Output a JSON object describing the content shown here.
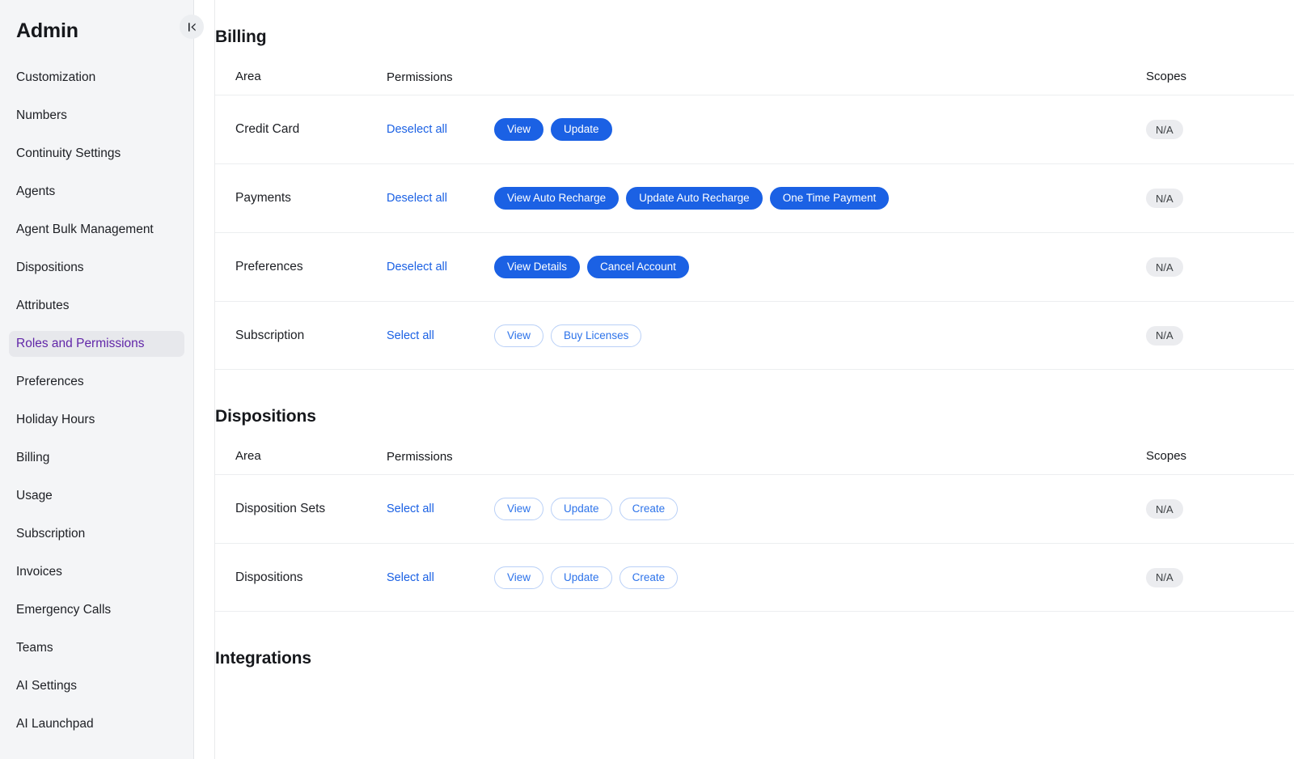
{
  "sidebar": {
    "title": "Admin",
    "collapse_icon": "collapse-left-icon",
    "active_item": "Roles and Permissions",
    "items": [
      {
        "label": "Customization"
      },
      {
        "label": "Numbers"
      },
      {
        "label": "Continuity Settings"
      },
      {
        "label": "Agents"
      },
      {
        "label": "Agent Bulk Management"
      },
      {
        "label": "Dispositions"
      },
      {
        "label": "Attributes"
      },
      {
        "label": "Roles and Permissions"
      },
      {
        "label": "Preferences"
      },
      {
        "label": "Holiday Hours"
      },
      {
        "label": "Billing"
      },
      {
        "label": "Usage"
      },
      {
        "label": "Subscription"
      },
      {
        "label": "Invoices"
      },
      {
        "label": "Emergency Calls"
      },
      {
        "label": "Teams"
      },
      {
        "label": "AI Settings"
      },
      {
        "label": "AI Launchpad"
      }
    ]
  },
  "colors": {
    "accent_blue": "#1b61e4",
    "link_blue": "#1b61e4",
    "pill_outline": "#b9d0f7",
    "active_nav_text": "#6126a8",
    "active_nav_bg": "#e7e8ec",
    "sidebar_bg": "#f4f5f7",
    "badge_bg": "#ebecef"
  },
  "columns": {
    "area": "Area",
    "permissions": "Permissions",
    "scopes": "Scopes"
  },
  "links": {
    "select_all": "Select all",
    "deselect_all": "Deselect all"
  },
  "sections": [
    {
      "title": "Billing",
      "rows": [
        {
          "area": "Credit Card",
          "select_link": "Deselect all",
          "scope": "N/A",
          "permissions": [
            {
              "label": "View",
              "selected": true
            },
            {
              "label": "Update",
              "selected": true
            }
          ]
        },
        {
          "area": "Payments",
          "select_link": "Deselect all",
          "scope": "N/A",
          "permissions": [
            {
              "label": "View Auto Recharge",
              "selected": true
            },
            {
              "label": "Update Auto Recharge",
              "selected": true
            },
            {
              "label": "One Time Payment",
              "selected": true
            }
          ]
        },
        {
          "area": "Preferences",
          "select_link": "Deselect all",
          "scope": "N/A",
          "permissions": [
            {
              "label": "View Details",
              "selected": true
            },
            {
              "label": "Cancel Account",
              "selected": true
            }
          ]
        },
        {
          "area": "Subscription",
          "select_link": "Select all",
          "scope": "N/A",
          "permissions": [
            {
              "label": "View",
              "selected": false
            },
            {
              "label": "Buy Licenses",
              "selected": false
            }
          ]
        }
      ]
    },
    {
      "title": "Dispositions",
      "rows": [
        {
          "area": "Disposition Sets",
          "select_link": "Select all",
          "scope": "N/A",
          "permissions": [
            {
              "label": "View",
              "selected": false
            },
            {
              "label": "Update",
              "selected": false
            },
            {
              "label": "Create",
              "selected": false
            }
          ]
        },
        {
          "area": "Dispositions",
          "select_link": "Select all",
          "scope": "N/A",
          "permissions": [
            {
              "label": "View",
              "selected": false
            },
            {
              "label": "Update",
              "selected": false
            },
            {
              "label": "Create",
              "selected": false
            }
          ]
        }
      ]
    },
    {
      "title": "Integrations",
      "rows": []
    }
  ]
}
